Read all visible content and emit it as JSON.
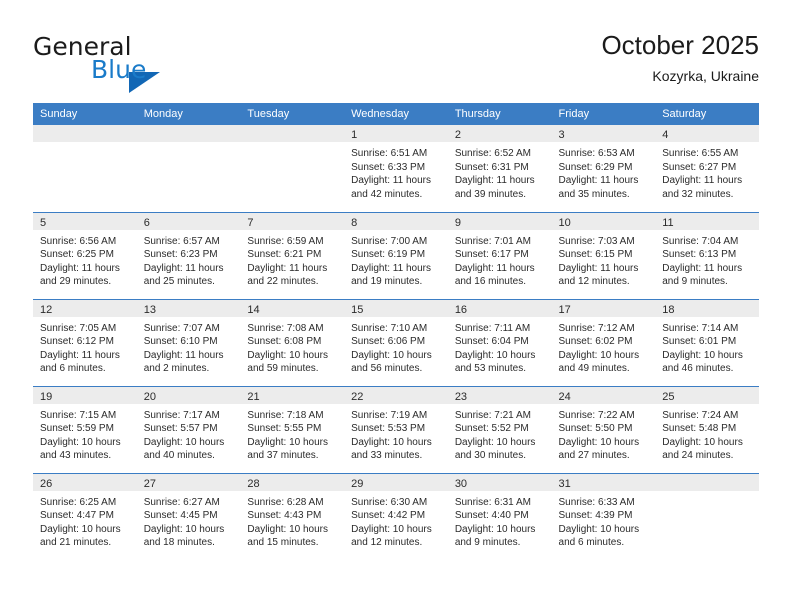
{
  "brand": {
    "name_top": "General",
    "name_bottom": "Blue",
    "accent_color": "#1267b5",
    "text_color": "#1a7bc9",
    "logo_icon": "triangle-icon"
  },
  "header": {
    "title": "October 2025",
    "location": "Kozyrka, Ukraine"
  },
  "theme": {
    "header_blue": "#3b7dc4",
    "daynum_gray": "#ececec"
  },
  "weekdays": [
    "Sunday",
    "Monday",
    "Tuesday",
    "Wednesday",
    "Thursday",
    "Friday",
    "Saturday"
  ],
  "weeks": [
    [
      {
        "day": "",
        "sunrise": "",
        "sunset": "",
        "daylight_a": "",
        "daylight_b": ""
      },
      {
        "day": "",
        "sunrise": "",
        "sunset": "",
        "daylight_a": "",
        "daylight_b": ""
      },
      {
        "day": "",
        "sunrise": "",
        "sunset": "",
        "daylight_a": "",
        "daylight_b": ""
      },
      {
        "day": "1",
        "sunrise": "Sunrise: 6:51 AM",
        "sunset": "Sunset: 6:33 PM",
        "daylight_a": "Daylight: 11 hours",
        "daylight_b": "and 42 minutes."
      },
      {
        "day": "2",
        "sunrise": "Sunrise: 6:52 AM",
        "sunset": "Sunset: 6:31 PM",
        "daylight_a": "Daylight: 11 hours",
        "daylight_b": "and 39 minutes."
      },
      {
        "day": "3",
        "sunrise": "Sunrise: 6:53 AM",
        "sunset": "Sunset: 6:29 PM",
        "daylight_a": "Daylight: 11 hours",
        "daylight_b": "and 35 minutes."
      },
      {
        "day": "4",
        "sunrise": "Sunrise: 6:55 AM",
        "sunset": "Sunset: 6:27 PM",
        "daylight_a": "Daylight: 11 hours",
        "daylight_b": "and 32 minutes."
      }
    ],
    [
      {
        "day": "5",
        "sunrise": "Sunrise: 6:56 AM",
        "sunset": "Sunset: 6:25 PM",
        "daylight_a": "Daylight: 11 hours",
        "daylight_b": "and 29 minutes."
      },
      {
        "day": "6",
        "sunrise": "Sunrise: 6:57 AM",
        "sunset": "Sunset: 6:23 PM",
        "daylight_a": "Daylight: 11 hours",
        "daylight_b": "and 25 minutes."
      },
      {
        "day": "7",
        "sunrise": "Sunrise: 6:59 AM",
        "sunset": "Sunset: 6:21 PM",
        "daylight_a": "Daylight: 11 hours",
        "daylight_b": "and 22 minutes."
      },
      {
        "day": "8",
        "sunrise": "Sunrise: 7:00 AM",
        "sunset": "Sunset: 6:19 PM",
        "daylight_a": "Daylight: 11 hours",
        "daylight_b": "and 19 minutes."
      },
      {
        "day": "9",
        "sunrise": "Sunrise: 7:01 AM",
        "sunset": "Sunset: 6:17 PM",
        "daylight_a": "Daylight: 11 hours",
        "daylight_b": "and 16 minutes."
      },
      {
        "day": "10",
        "sunrise": "Sunrise: 7:03 AM",
        "sunset": "Sunset: 6:15 PM",
        "daylight_a": "Daylight: 11 hours",
        "daylight_b": "and 12 minutes."
      },
      {
        "day": "11",
        "sunrise": "Sunrise: 7:04 AM",
        "sunset": "Sunset: 6:13 PM",
        "daylight_a": "Daylight: 11 hours",
        "daylight_b": "and 9 minutes."
      }
    ],
    [
      {
        "day": "12",
        "sunrise": "Sunrise: 7:05 AM",
        "sunset": "Sunset: 6:12 PM",
        "daylight_a": "Daylight: 11 hours",
        "daylight_b": "and 6 minutes."
      },
      {
        "day": "13",
        "sunrise": "Sunrise: 7:07 AM",
        "sunset": "Sunset: 6:10 PM",
        "daylight_a": "Daylight: 11 hours",
        "daylight_b": "and 2 minutes."
      },
      {
        "day": "14",
        "sunrise": "Sunrise: 7:08 AM",
        "sunset": "Sunset: 6:08 PM",
        "daylight_a": "Daylight: 10 hours",
        "daylight_b": "and 59 minutes."
      },
      {
        "day": "15",
        "sunrise": "Sunrise: 7:10 AM",
        "sunset": "Sunset: 6:06 PM",
        "daylight_a": "Daylight: 10 hours",
        "daylight_b": "and 56 minutes."
      },
      {
        "day": "16",
        "sunrise": "Sunrise: 7:11 AM",
        "sunset": "Sunset: 6:04 PM",
        "daylight_a": "Daylight: 10 hours",
        "daylight_b": "and 53 minutes."
      },
      {
        "day": "17",
        "sunrise": "Sunrise: 7:12 AM",
        "sunset": "Sunset: 6:02 PM",
        "daylight_a": "Daylight: 10 hours",
        "daylight_b": "and 49 minutes."
      },
      {
        "day": "18",
        "sunrise": "Sunrise: 7:14 AM",
        "sunset": "Sunset: 6:01 PM",
        "daylight_a": "Daylight: 10 hours",
        "daylight_b": "and 46 minutes."
      }
    ],
    [
      {
        "day": "19",
        "sunrise": "Sunrise: 7:15 AM",
        "sunset": "Sunset: 5:59 PM",
        "daylight_a": "Daylight: 10 hours",
        "daylight_b": "and 43 minutes."
      },
      {
        "day": "20",
        "sunrise": "Sunrise: 7:17 AM",
        "sunset": "Sunset: 5:57 PM",
        "daylight_a": "Daylight: 10 hours",
        "daylight_b": "and 40 minutes."
      },
      {
        "day": "21",
        "sunrise": "Sunrise: 7:18 AM",
        "sunset": "Sunset: 5:55 PM",
        "daylight_a": "Daylight: 10 hours",
        "daylight_b": "and 37 minutes."
      },
      {
        "day": "22",
        "sunrise": "Sunrise: 7:19 AM",
        "sunset": "Sunset: 5:53 PM",
        "daylight_a": "Daylight: 10 hours",
        "daylight_b": "and 33 minutes."
      },
      {
        "day": "23",
        "sunrise": "Sunrise: 7:21 AM",
        "sunset": "Sunset: 5:52 PM",
        "daylight_a": "Daylight: 10 hours",
        "daylight_b": "and 30 minutes."
      },
      {
        "day": "24",
        "sunrise": "Sunrise: 7:22 AM",
        "sunset": "Sunset: 5:50 PM",
        "daylight_a": "Daylight: 10 hours",
        "daylight_b": "and 27 minutes."
      },
      {
        "day": "25",
        "sunrise": "Sunrise: 7:24 AM",
        "sunset": "Sunset: 5:48 PM",
        "daylight_a": "Daylight: 10 hours",
        "daylight_b": "and 24 minutes."
      }
    ],
    [
      {
        "day": "26",
        "sunrise": "Sunrise: 6:25 AM",
        "sunset": "Sunset: 4:47 PM",
        "daylight_a": "Daylight: 10 hours",
        "daylight_b": "and 21 minutes."
      },
      {
        "day": "27",
        "sunrise": "Sunrise: 6:27 AM",
        "sunset": "Sunset: 4:45 PM",
        "daylight_a": "Daylight: 10 hours",
        "daylight_b": "and 18 minutes."
      },
      {
        "day": "28",
        "sunrise": "Sunrise: 6:28 AM",
        "sunset": "Sunset: 4:43 PM",
        "daylight_a": "Daylight: 10 hours",
        "daylight_b": "and 15 minutes."
      },
      {
        "day": "29",
        "sunrise": "Sunrise: 6:30 AM",
        "sunset": "Sunset: 4:42 PM",
        "daylight_a": "Daylight: 10 hours",
        "daylight_b": "and 12 minutes."
      },
      {
        "day": "30",
        "sunrise": "Sunrise: 6:31 AM",
        "sunset": "Sunset: 4:40 PM",
        "daylight_a": "Daylight: 10 hours",
        "daylight_b": "and 9 minutes."
      },
      {
        "day": "31",
        "sunrise": "Sunrise: 6:33 AM",
        "sunset": "Sunset: 4:39 PM",
        "daylight_a": "Daylight: 10 hours",
        "daylight_b": "and 6 minutes."
      },
      {
        "day": "",
        "sunrise": "",
        "sunset": "",
        "daylight_a": "",
        "daylight_b": ""
      }
    ]
  ]
}
